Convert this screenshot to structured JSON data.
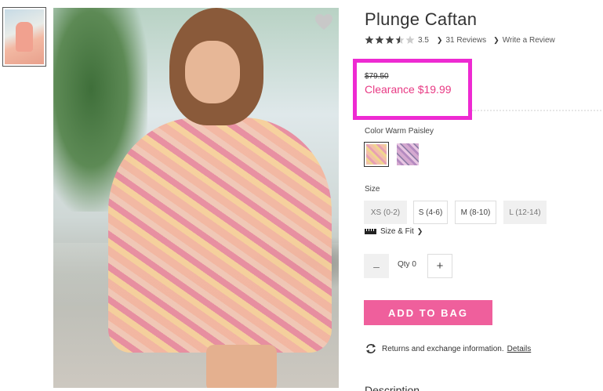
{
  "product": {
    "title": "Plunge Caftan",
    "rating_value": "3.5",
    "rating_stars": 3.5,
    "reviews_link": "31 Reviews",
    "write_review_link": "Write a Review"
  },
  "price": {
    "original": "$79.50",
    "clearance": "Clearance $19.99",
    "highlight_color": "#ee2ad2",
    "sale_color": "#e83a84"
  },
  "color": {
    "label": "Color Warm Paisley",
    "swatches": [
      {
        "name": "Warm Paisley",
        "selected": true
      },
      {
        "name": "Purple Paisley",
        "selected": false
      }
    ]
  },
  "size": {
    "label": "Size",
    "options": [
      {
        "label": "XS (0-2)",
        "available": false
      },
      {
        "label": "S (4-6)",
        "available": true
      },
      {
        "label": "M (8-10)",
        "available": true
      },
      {
        "label": "L (12-14)",
        "available": false
      }
    ],
    "fit_link": "Size & Fit"
  },
  "quantity": {
    "minus": "–",
    "label": "Qty 0",
    "plus": "+"
  },
  "add_to_bag": {
    "label": "ADD TO BAG",
    "color": "#ef5f9c"
  },
  "returns": {
    "text": "Returns and exchange information.",
    "details_link": "Details"
  },
  "description_heading": "Description",
  "icons": [
    "heart-icon",
    "star-icon",
    "chevron-right-icon",
    "ruler-icon",
    "refresh-icon"
  ]
}
